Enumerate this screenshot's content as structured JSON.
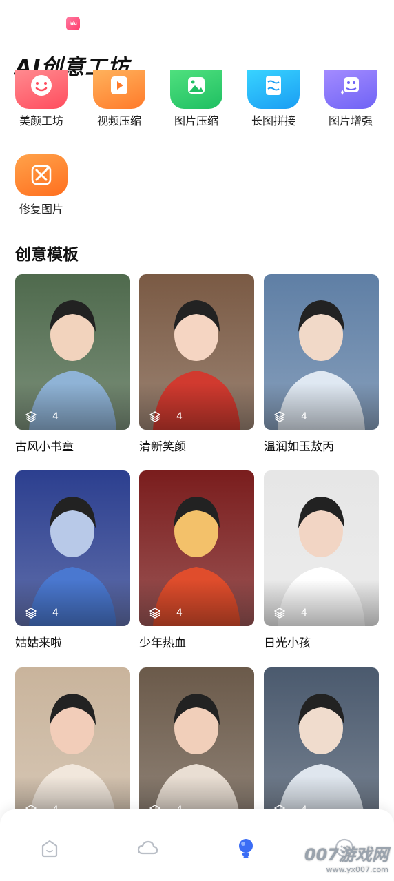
{
  "app": {
    "logo_text": "lulu"
  },
  "header": {
    "title": "AI创意工坊"
  },
  "tools": [
    {
      "label": "美颜工坊",
      "icon": "smile-face-icon",
      "color_from": "#ff8a8f",
      "color_to": "#ff4d5e"
    },
    {
      "label": "视频压缩",
      "icon": "video-play-icon",
      "color_from": "#ffb25c",
      "color_to": "#ff7a2a"
    },
    {
      "label": "图片压缩",
      "icon": "image-icon",
      "color_from": "#4fe07e",
      "color_to": "#1fbf62"
    },
    {
      "label": "长图拼接",
      "icon": "stitch-icon",
      "color_from": "#38d3ff",
      "color_to": "#1a9df3"
    },
    {
      "label": "图片增强",
      "icon": "sparkle-image-icon",
      "color_from": "#a38bff",
      "color_to": "#6f63f5"
    },
    {
      "label": "修复图片",
      "icon": "repair-tools-icon",
      "color_from": "#ffa24a",
      "color_to": "#ff6f1f"
    }
  ],
  "templates": {
    "section_title": "创意模板",
    "items": [
      {
        "name": "古风小书童",
        "count": "4",
        "palette": [
          "#4f6a4d",
          "#8fb3d6",
          "#f2d3bd"
        ]
      },
      {
        "name": "清新笑颜",
        "count": "4",
        "palette": [
          "#7a5a44",
          "#d13a2f",
          "#f5d5c2"
        ]
      },
      {
        "name": "温润如玉敖丙",
        "count": "4",
        "palette": [
          "#5f7fa5",
          "#dfe8f2",
          "#f1d9c8"
        ]
      },
      {
        "name": "姑姑来啦",
        "count": "4",
        "palette": [
          "#2c3f8f",
          "#4a78d0",
          "#b8c9e8"
        ]
      },
      {
        "name": "少年热血",
        "count": "4",
        "palette": [
          "#7a1d1d",
          "#e04d2c",
          "#f3c16a"
        ]
      },
      {
        "name": "日光小孩",
        "count": "4",
        "palette": [
          "#e6e6e6",
          "#ffffff",
          "#f2d5c4"
        ]
      },
      {
        "name": "",
        "count": "4",
        "palette": [
          "#c9b49c",
          "#f1e7dc",
          "#f2cdb9"
        ]
      },
      {
        "name": "",
        "count": "4",
        "palette": [
          "#6b5a4a",
          "#e9ded3",
          "#f1cfba"
        ]
      },
      {
        "name": "",
        "count": "4",
        "palette": [
          "#4b5a6e",
          "#dfe6ee",
          "#f0dccd"
        ]
      }
    ]
  },
  "tabbar": {
    "tabs": [
      {
        "icon": "home-icon",
        "active": false
      },
      {
        "icon": "cloud-icon",
        "active": false
      },
      {
        "icon": "bulb-icon",
        "active": true
      },
      {
        "icon": "smile-chat-icon",
        "active": false
      }
    ],
    "active_color": "#3b6df5",
    "inactive_color": "#b9bec6"
  },
  "watermark": {
    "main": "007游戏网",
    "sub": "www.yx007.com"
  }
}
